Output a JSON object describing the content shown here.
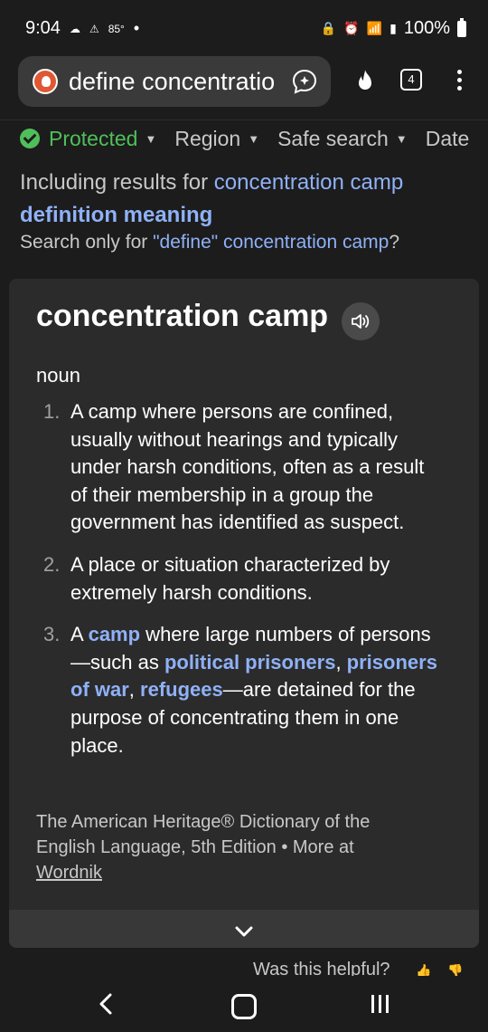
{
  "status_bar": {
    "time": "9:04",
    "temperature": "85°",
    "battery": "100%"
  },
  "browser": {
    "address_text": "define concentratio",
    "tab_count": "4"
  },
  "filters": {
    "protected": "Protected",
    "region": "Region",
    "safe_search": "Safe search",
    "date": "Date"
  },
  "spelling": {
    "including_prefix": "Including results for ",
    "including_link": "concentration camp",
    "including_bold": "definition meaning",
    "search_only_prefix": "Search only for ",
    "search_only_link": "\"define\" concentration camp",
    "search_only_suffix": "?"
  },
  "definition": {
    "word": "concentration camp",
    "part_of_speech": "noun",
    "senses": [
      {
        "num": "1.",
        "text": "A camp where persons are confined, usually without hearings and typically under harsh conditions, often as a result of their membership in a group the government has identified as suspect."
      },
      {
        "num": "2.",
        "text": "A place or situation characterized by extremely harsh conditions."
      },
      {
        "num": "3.",
        "a": "A ",
        "camp": "camp",
        "b": " where large numbers of persons—such as ",
        "political_prisoners": "political prisoners",
        "c": ", ",
        "prisoners_of_war": "prisoners of war",
        "d": ", ",
        "refugees": "refugees",
        "e": "—are detained for the purpose of concentrating them in one place."
      }
    ],
    "source": "The American Heritage® Dictionary of the English Language, 5th Edition",
    "more_at": "More at",
    "wordnik": "Wordnik"
  },
  "feedback": {
    "helpful": "Was this helpful?"
  },
  "colors": {
    "background": "#1c1c1c",
    "card": "#2b2b2b",
    "link": "#8fb1f7",
    "protected_green": "#4fbf5a"
  }
}
